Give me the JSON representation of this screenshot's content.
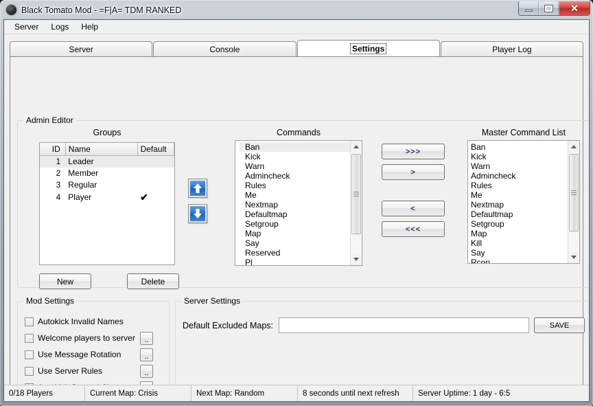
{
  "window": {
    "title": "Black Tomato Mod - =F|A= TDM RANKED",
    "icon": "app-circle-icon",
    "minimize_label": "",
    "maximize_label": "",
    "close_label": "✕"
  },
  "menubar": {
    "items": [
      {
        "label": "Server"
      },
      {
        "label": "Logs"
      },
      {
        "label": "Help"
      }
    ]
  },
  "tabs": [
    {
      "label": "Server",
      "active": false
    },
    {
      "label": "Console",
      "active": false
    },
    {
      "label": "Settings",
      "active": true
    },
    {
      "label": "Player Log",
      "active": false
    }
  ],
  "admin_editor": {
    "title": "Admin Editor",
    "groups": {
      "heading": "Groups",
      "columns": [
        "ID",
        "Name",
        "Default"
      ],
      "rows": [
        {
          "id": "1",
          "name": "Leader",
          "default": "",
          "selected": true
        },
        {
          "id": "2",
          "name": "Member",
          "default": "",
          "selected": false
        },
        {
          "id": "3",
          "name": "Regular",
          "default": "",
          "selected": false
        },
        {
          "id": "4",
          "name": "Player",
          "default": "✔",
          "selected": false
        }
      ],
      "new_label": "New",
      "delete_label": "Delete",
      "move_up_icon": "arrow-up-icon",
      "move_down_icon": "arrow-down-icon"
    },
    "commands": {
      "heading": "Commands",
      "items": [
        "Ban",
        "Kick",
        "Warn",
        "Admincheck",
        "Rules",
        "Me",
        "Nextmap",
        "Defaultmap",
        "Setgroup",
        "Map",
        "Say",
        "Reserved",
        "Pl"
      ],
      "selected_index": 0
    },
    "transfer": {
      "add_all_label": ">>>",
      "add_label": ">",
      "remove_label": "<",
      "remove_all_label": "<<<"
    },
    "master_list": {
      "heading": "Master Command List",
      "items": [
        "Ban",
        "Kick",
        "Warn",
        "Admincheck",
        "Rules",
        "Me",
        "Nextmap",
        "Defaultmap",
        "Setgroup",
        "Map",
        "Kill",
        "Say",
        "Rcon"
      ]
    }
  },
  "mod_settings": {
    "title": "Mod Settings",
    "options": [
      {
        "label": "Autokick Invalid Names",
        "checked": false,
        "has_config": false
      },
      {
        "label": "Welcome players to server",
        "checked": false,
        "has_config": true
      },
      {
        "label": "Use Message Rotation",
        "checked": false,
        "has_config": true
      },
      {
        "label": "Use Server Rules",
        "checked": false,
        "has_config": true
      },
      {
        "label": "Autokick Second Chance",
        "checked": false,
        "has_config": true
      }
    ],
    "config_button_label": ".."
  },
  "server_settings": {
    "title": "Server Settings",
    "excluded_maps_label": "Default Excluded Maps:",
    "excluded_maps_value": "",
    "excluded_maps_placeholder": "",
    "save_label": "SAVE"
  },
  "statusbar": {
    "players": "0/18 Players",
    "current_map": "Current Map: Crisis",
    "next_map": "Next Map: Random",
    "refresh": "8 seconds until next refresh",
    "uptime": "Server Uptime: 1 day - 6:5"
  },
  "colors": {
    "accent_blue": "#2b74c9",
    "check_green": "#52b030",
    "close_red": "#cf3f38",
    "window_bg": "#f0f0f0"
  }
}
